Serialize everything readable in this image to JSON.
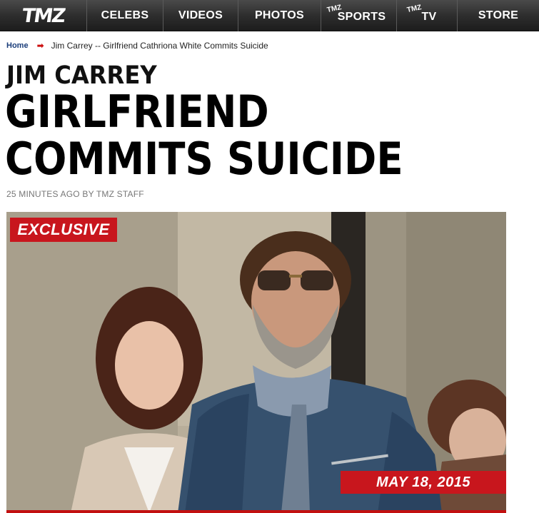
{
  "nav": {
    "logo": "TMZ",
    "items": [
      {
        "label": "CELEBS",
        "prefix": ""
      },
      {
        "label": "VIDEOS",
        "prefix": ""
      },
      {
        "label": "PHOTOS",
        "prefix": ""
      },
      {
        "label": "SPORTS",
        "prefix": "TMZ"
      },
      {
        "label": "TV",
        "prefix": "TMZ"
      },
      {
        "label": "STORE",
        "prefix": ""
      }
    ]
  },
  "breadcrumb": {
    "home": "Home",
    "current": "Jim Carrey -- Girlfriend Cathriona White Commits Suicide"
  },
  "article": {
    "kicker": "JIM CARREY",
    "headline_line1": "GIRLFRIEND",
    "headline_line2": "COMMITS SUICIDE",
    "byline": "25 MINUTES AGO BY TMZ STAFF"
  },
  "photo": {
    "badge": "EXCLUSIVE",
    "date": "MAY 18, 2015"
  },
  "colors": {
    "accent_red": "#c8161d",
    "nav_bg": "#2e2e2e",
    "link_blue": "#1a3d7a"
  }
}
